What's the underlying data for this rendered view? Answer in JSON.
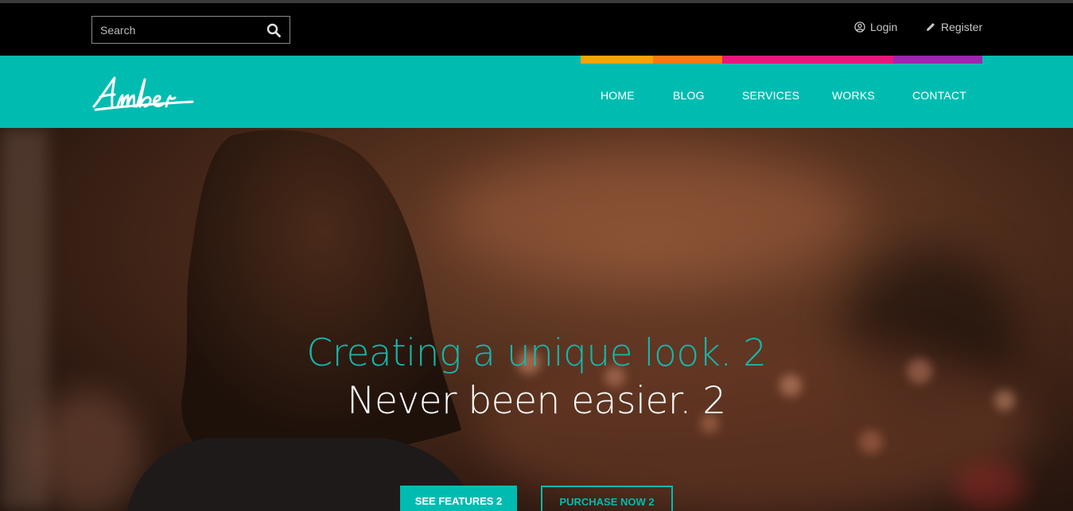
{
  "topbar": {
    "search": {
      "placeholder": "Search",
      "value": ""
    },
    "login_label": "Login",
    "register_label": "Register"
  },
  "icons": {
    "search": "search-icon",
    "login": "user-circle-icon",
    "register": "pencil-icon"
  },
  "brand": {
    "logo_text": "Amber"
  },
  "color_strip": [
    "#f7a400",
    "#f87c0c",
    "#e4197a",
    "#9c27b0"
  ],
  "nav": {
    "items": [
      {
        "label": "HOME"
      },
      {
        "label": "BLOG"
      },
      {
        "label": "SERVICES"
      },
      {
        "label": "WORKS"
      },
      {
        "label": "CONTACT"
      }
    ]
  },
  "hero": {
    "headline": "Creating a unique look. 2",
    "subheadline": "Never been easier. 2",
    "primary_cta": "SEE FEATURES 2",
    "secondary_cta": "PURCHASE NOW 2"
  },
  "colors": {
    "accent": "#00bcb0",
    "topbar_bg": "#000000",
    "headline": "#14b8ac"
  }
}
